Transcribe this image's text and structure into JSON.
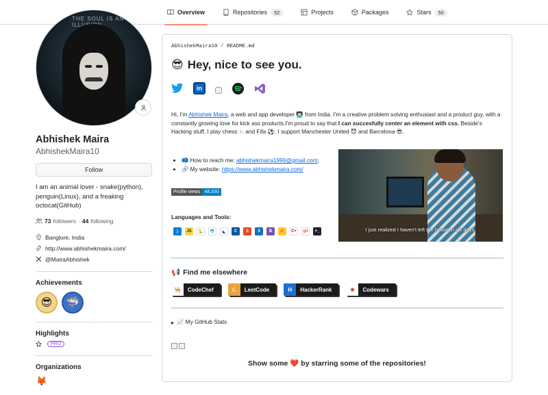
{
  "nav": {
    "tabs": [
      {
        "label": "Overview",
        "icon": "book-icon"
      },
      {
        "label": "Repositories",
        "count": "52",
        "icon": "repo-icon"
      },
      {
        "label": "Projects",
        "icon": "table-icon"
      },
      {
        "label": "Packages",
        "icon": "package-icon"
      },
      {
        "label": "Stars",
        "count": "50",
        "icon": "star-icon"
      }
    ]
  },
  "profile": {
    "avatar_text": "THE SOUL IS AN ILLUSION",
    "fullname": "Abhishek Maira",
    "username": "AbhishekMaira10",
    "follow_label": "Follow",
    "bio": "I am an animal lover - snake(python), penguin(Linux), and a freaking octocat(GitHub)",
    "followers": "73",
    "followers_label": "followers",
    "following": "44",
    "following_label": "following",
    "location": "Banglore, India",
    "website": "http://www.abhishekmaira.com/",
    "twitter": "@MairaAbhishek",
    "achievements_title": "Achievements",
    "highlights_title": "Highlights",
    "pro_label": "PRO",
    "organizations_title": "Organizations"
  },
  "readme": {
    "breadcrumb_user": "AbhishekMaira10",
    "breadcrumb_sep": "/",
    "breadcrumb_file": "README.md",
    "heading_emoji": "😎",
    "heading": "Hey, nice to see you.",
    "intro_pre": "Hi, I'm ",
    "intro_link": "Abhishek Maira",
    "intro_mid": ", a web and app developer 👨🏻‍💻 from India. I'm a creative problem solving enthusiast and a product guy, with a constantly growing love for kick ass products.I'm proud to say that ",
    "intro_bold": "I can succesfully center an element with css.",
    "intro_post": " Beside's Hacking stuff, I play chess ♘ and Fifa ⚽. I support Manchester United 😈 and Barcelona 😎.",
    "reach_label": "📫 How to reach me: ",
    "reach_email": "abhishekmaira1999@gmail.com",
    "reach_suffix": ";",
    "site_label": "🔗 My website: ",
    "site_url": "https://www.abhishekmaira.com/",
    "views_label": "Profile views",
    "views_count": "48,330",
    "gif_caption": "I just realized I haven't left the house in six days.",
    "languages_title": "Languages and Tools:",
    "find_emoji": "📢",
    "find_title": "Find me elsewhere",
    "profiles": [
      {
        "label": "CodeChef",
        "bg": "#1b1b1b",
        "icon_bg": "#ffffff",
        "icon": "👨‍🍳"
      },
      {
        "label": "LeetCode",
        "bg": "#1b1b1b",
        "icon_bg": "#e8a33d",
        "icon": "ℒ"
      },
      {
        "label": "HackerRank",
        "bg": "#1b1b1b",
        "icon_bg": "#1f6fd1",
        "icon": "H"
      },
      {
        "label": "Codewars",
        "bg": "#1b1b1b",
        "icon_bg": "#ffffff",
        "icon": "✺"
      }
    ],
    "stats_label": "📈 My GitHub Stats",
    "star_pre": "Show some ",
    "star_heart": "❤️",
    "star_post": " by starring some of the repositories!"
  }
}
